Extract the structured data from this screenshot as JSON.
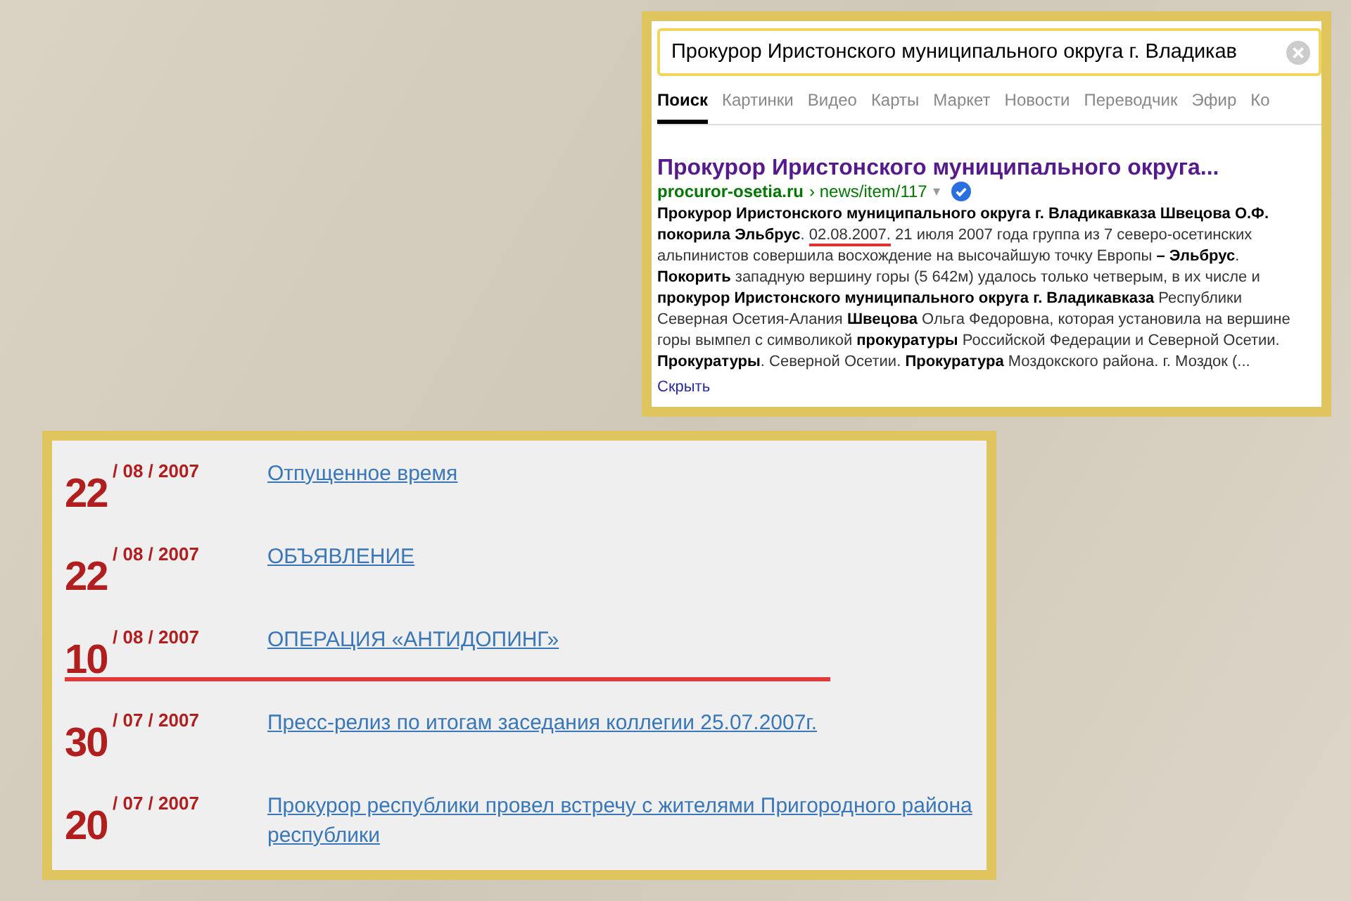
{
  "search_panel": {
    "query": "Прокурор Иристонского муниципального округа г. Владикав",
    "tabs": [
      {
        "label": "Поиск",
        "selected": true
      },
      {
        "label": "Картинки",
        "selected": false
      },
      {
        "label": "Видео",
        "selected": false
      },
      {
        "label": "Карты",
        "selected": false
      },
      {
        "label": "Маркет",
        "selected": false
      },
      {
        "label": "Новости",
        "selected": false
      },
      {
        "label": "Переводчик",
        "selected": false
      },
      {
        "label": "Эфир",
        "selected": false
      },
      {
        "label": "Ко",
        "selected": false
      }
    ],
    "result": {
      "title": "Прокурор Иристонского муниципального округа...",
      "site": "procuror-osetia.ru",
      "path": "› news/item/117",
      "path_arrow": "▾",
      "verified": true,
      "snippet": [
        {
          "text": "**Прокурор Иристонского муниципального округа г. Владикавказа Швецова О.Ф. покорила Эльбрус**. ",
          "underlined": false
        },
        {
          "text": "02.08.2007.",
          "underlined": true
        },
        {
          "text": " 21 июля 2007 года группа из 7 северо-осетинских альпинистов совершила восхождение на высочайшую точку Европы **– Эльбрус**. **Покорить** западную вершину горы (5 642м) удалось только четверым, в их числе и **прокурор Иристонского муниципального округа г. Владикавказа** Республики Северная Осетия-Алания **Швецова** Ольга Федоровна, которая установила на вершине горы вымпел с символикой **прокуратуры** Российской Федерации и Северной Осетии. **Прокуратуры**. Северной Осетии. **Прокуратура** Моздокского района. г. Моздок (...",
          "underlined": false
        }
      ],
      "hide_link": "Скрыть"
    }
  },
  "news": [
    {
      "day": "22",
      "month_year": "/ 08 / 2007",
      "title": "Отпущенное время",
      "highlighted": false
    },
    {
      "day": "22",
      "month_year": "/ 08 / 2007",
      "title": "ОБЪЯВЛЕНИЕ",
      "highlighted": false
    },
    {
      "day": "10",
      "month_year": "/ 08 / 2007",
      "title": "ОПЕРАЦИЯ «АНТИДОПИНГ»",
      "highlighted": true
    },
    {
      "day": "30",
      "month_year": "/ 07 / 2007",
      "title": "Пресс-релиз по итогам заседания коллегии 25.07.2007г.",
      "highlighted": false
    },
    {
      "day": "20",
      "month_year": "/ 07 / 2007",
      "title": "Прокурор республики провел встречу с жителями Пригородного района республики",
      "highlighted": false
    }
  ]
}
